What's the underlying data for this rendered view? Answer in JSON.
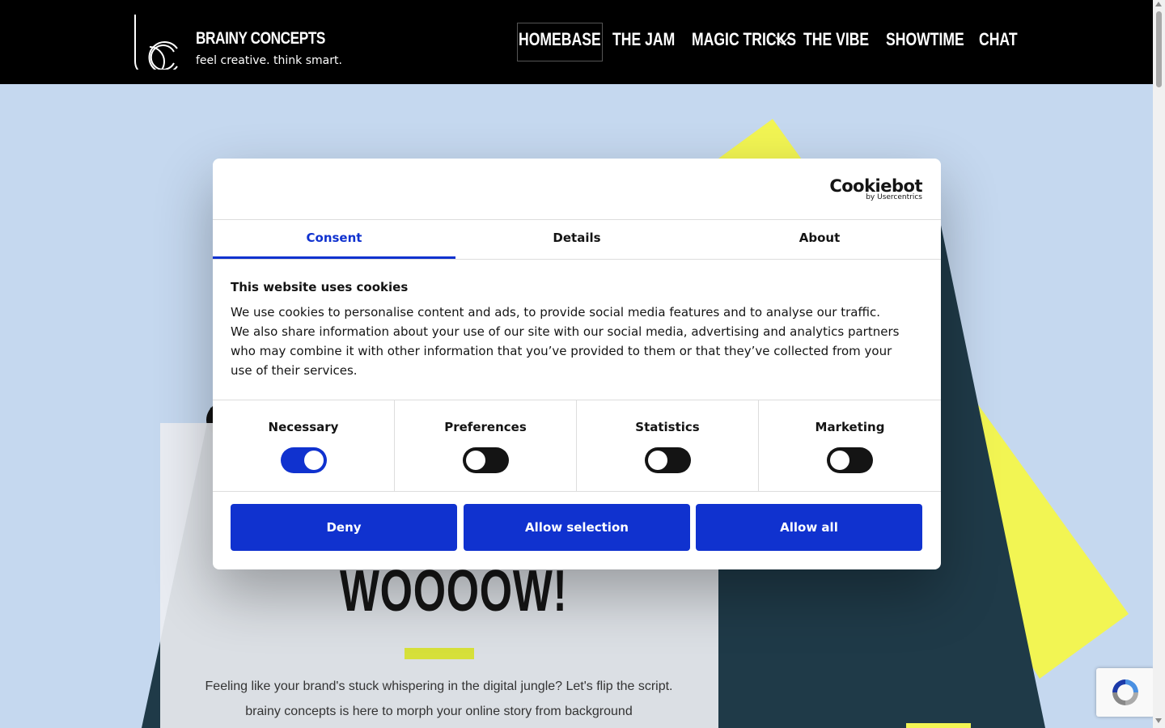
{
  "header": {
    "brand_name": "BRAINY CONCEPTS",
    "tagline": "feel creative. think smart.",
    "nav": [
      {
        "label": "HOMEBASE",
        "active": true
      },
      {
        "label": "THE JAM"
      },
      {
        "label": "MAGIC TRICKS",
        "has_dropdown": true
      },
      {
        "label": "THE VIBE"
      },
      {
        "label": "SHOWTIME"
      },
      {
        "label": "CHAT"
      }
    ]
  },
  "hero": {
    "headline": "WOOOOW!",
    "text": "Feeling like your brand's stuck whispering in the digital jungle? Let's flip the script. brainy concepts is here to morph your online story from background"
  },
  "cookie_dialog": {
    "logo_main": "Cookiebot",
    "logo_sub": "by Usercentrics",
    "tabs": [
      {
        "label": "Consent",
        "active": true
      },
      {
        "label": "Details"
      },
      {
        "label": "About"
      }
    ],
    "title": "This website uses cookies",
    "body": "We use cookies to personalise content and ads, to provide social media features and to analyse our traffic. We also share information about your use of our site with our social media, advertising and analytics partners who may combine it with other information that you’ve provided to them or that they’ve collected from your use of their services.",
    "toggles": [
      {
        "label": "Necessary",
        "on": true
      },
      {
        "label": "Preferences",
        "on": false
      },
      {
        "label": "Statistics",
        "on": false
      },
      {
        "label": "Marketing",
        "on": false
      }
    ],
    "buttons": {
      "deny": "Deny",
      "allow_selection": "Allow selection",
      "allow_all": "Allow all"
    }
  },
  "colors": {
    "header_bg": "#000000",
    "page_bg": "#c5d8ef",
    "accent_blue": "#1032cf",
    "accent_yellow": "#f2f553"
  }
}
